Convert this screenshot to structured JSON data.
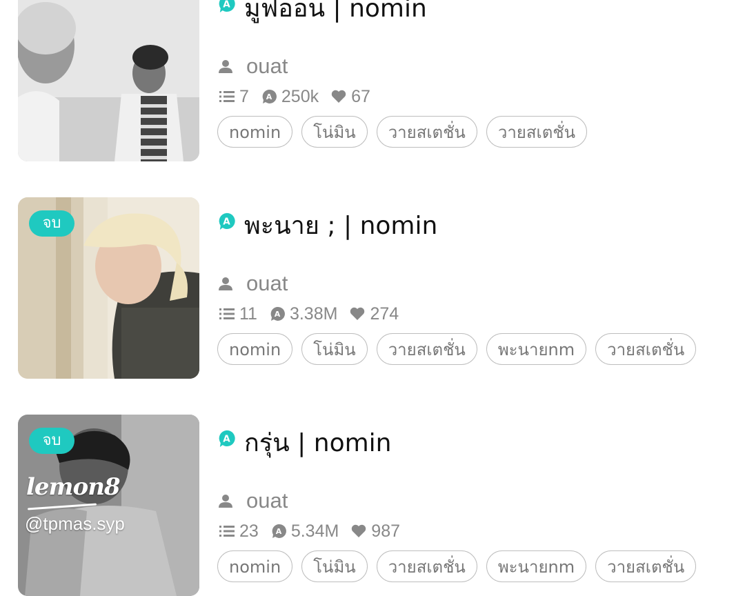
{
  "stories": [
    {
      "title": "มูฟออน | nomin",
      "author": "ouat",
      "chapters": "7",
      "views": "250k",
      "likes": "67",
      "badge": "",
      "tags": [
        "nomin",
        "โน่มิน",
        "วายสเตชั่น",
        "วายสเตชั่น"
      ]
    },
    {
      "title": "พะนาย ; | nomin",
      "author": "ouat",
      "chapters": "11",
      "views": "3.38M",
      "likes": "274",
      "badge": "จบ",
      "tags": [
        "nomin",
        "โน่มิน",
        "วายสเตชั่น",
        "พะนายnm",
        "วายสเตชั่น"
      ]
    },
    {
      "title": "กรุ่น | nomin",
      "author": "ouat",
      "chapters": "23",
      "views": "5.34M",
      "likes": "987",
      "badge": "จบ",
      "tags": [
        "nomin",
        "โน่มิน",
        "วายสเตชั่น",
        "พะนายnm",
        "วายสเตชั่น"
      ]
    }
  ],
  "watermark": {
    "logo": "lemon8",
    "handle": "@tpmas.syp"
  },
  "icons": {
    "app": "app-a-icon",
    "author": "person-icon",
    "chapters": "list-icon",
    "views": "eye-a-icon",
    "likes": "heart-icon"
  },
  "colors": {
    "accent": "#1fc9c0",
    "muted": "#888888",
    "tag_border": "#bdbdbd"
  }
}
